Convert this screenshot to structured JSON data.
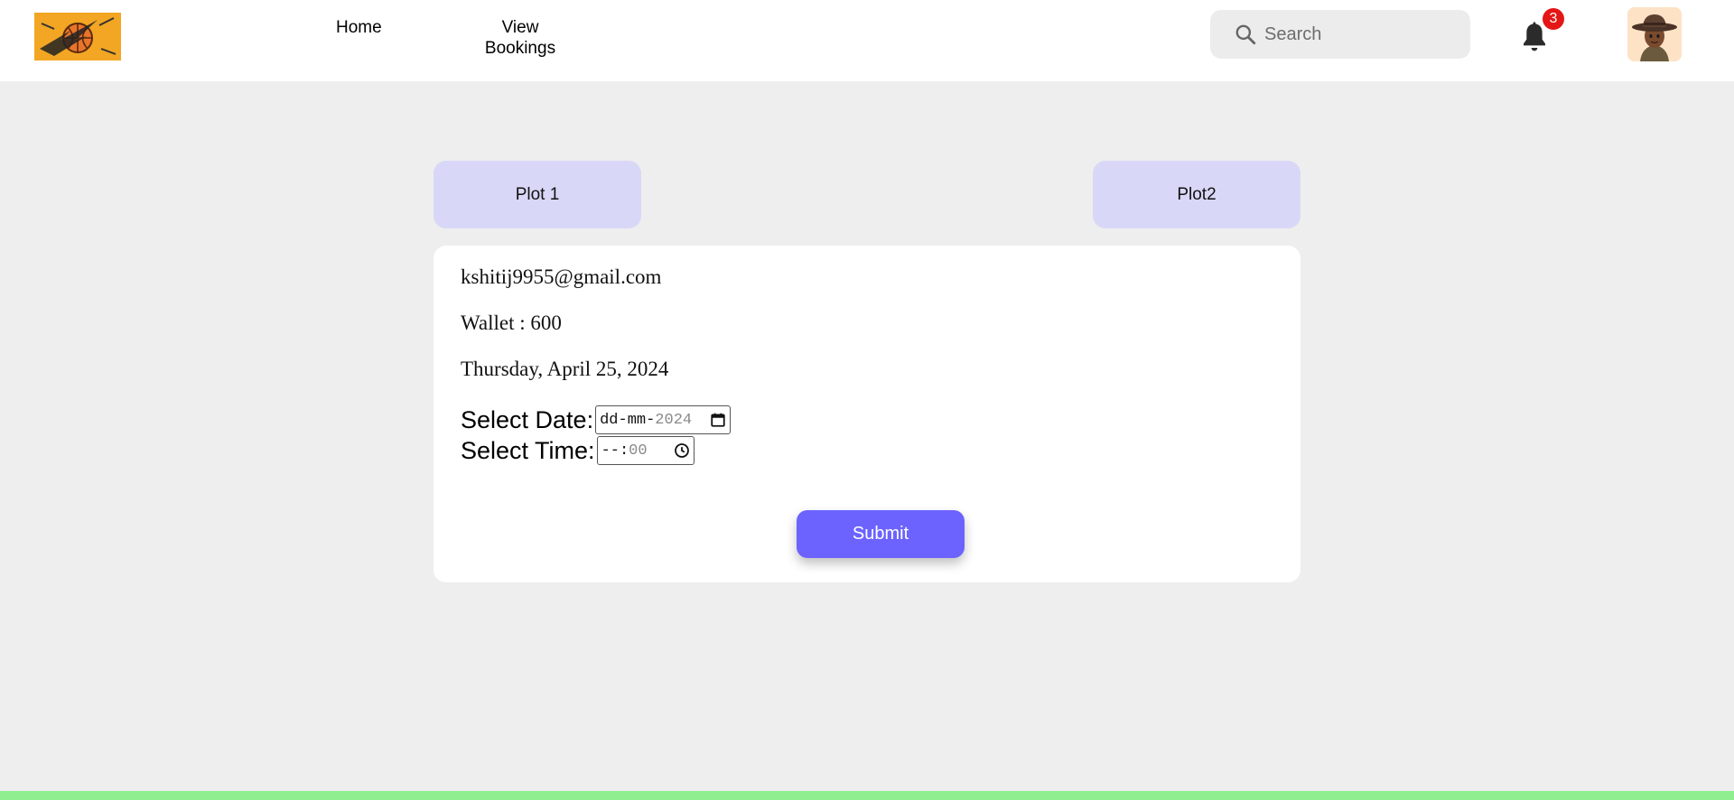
{
  "header": {
    "nav": {
      "home": "Home",
      "bookings": "View Bookings"
    },
    "search": {
      "placeholder": "Search",
      "icon": "search-icon"
    },
    "notifications": {
      "count": "3",
      "icon": "bell-icon",
      "badge_color": "#e51616"
    },
    "avatar": {
      "icon": "cowboy-avatar"
    }
  },
  "plots": {
    "plot1": "Plot 1",
    "plot2": "Plot2"
  },
  "card": {
    "email": "kshitij9955@gmail.com",
    "wallet": "Wallet : 600",
    "current_date": "Thursday, April 25, 2024",
    "date_label": "Select Date:",
    "date_value": {
      "day": "dd",
      "sep1": "-",
      "month": "mm",
      "sep2": "-",
      "year": "2024"
    },
    "time_label": "Select Time:",
    "time_value": {
      "hours": "--",
      "sep": ":",
      "minutes": "00"
    },
    "submit": "Submit"
  },
  "colors": {
    "accent": "#6c63ff",
    "plot_button": "#d8d7f7",
    "background": "#eeeeee",
    "footer": "#90ee90"
  }
}
